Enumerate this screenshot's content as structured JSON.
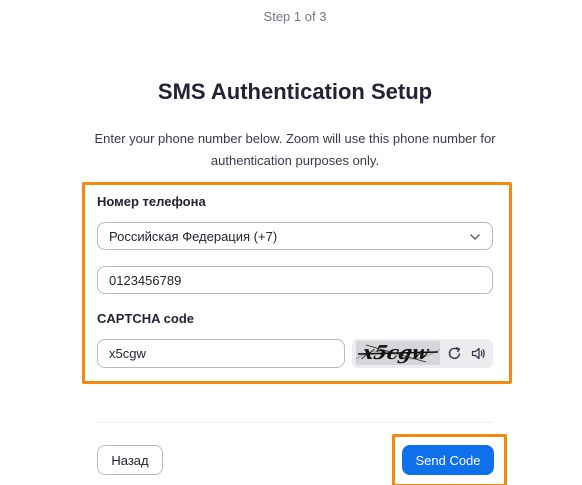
{
  "header": {
    "step": "Step 1 of 3",
    "title": "SMS Authentication Setup",
    "description": "Enter your phone number below. Zoom will use this phone number for authentication purposes only."
  },
  "form": {
    "phone_label": "Номер телефона",
    "country_value": "Российская Федерация (+7)",
    "phone_value": "0123456789",
    "captcha_label": "CAPTCHA code",
    "captcha_value": "x5cgw",
    "captcha_image_text": "x5cgw",
    "captcha_icons": [
      "refresh-icon",
      "speaker-icon"
    ]
  },
  "footer": {
    "back_label": "Назад",
    "send_label": "Send Code"
  },
  "colors": {
    "accent": "#0e71eb",
    "highlight": "#f5890f"
  }
}
